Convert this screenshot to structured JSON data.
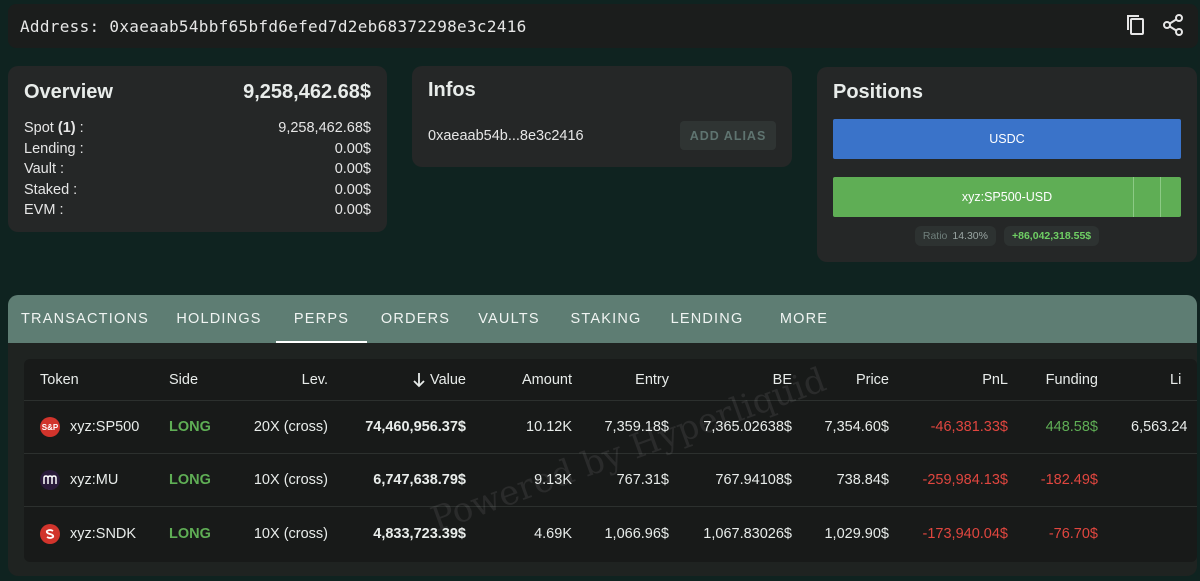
{
  "address": {
    "label": "Address:",
    "value": "0xaeaab54bbf65bfd6efed7d2eb68372298e3c2416"
  },
  "icons": {
    "copy": "copy-icon",
    "share": "share-icon"
  },
  "overview": {
    "title": "Overview",
    "total": "9,258,462.68$",
    "rows": [
      {
        "label_prefix": "Spot ",
        "label_bold": "(1)",
        "label_suffix": " :",
        "value": "9,258,462.68$"
      },
      {
        "label": "Lending :",
        "value": "0.00$"
      },
      {
        "label": "Vault :",
        "value": "0.00$"
      },
      {
        "label": "Staked :",
        "value": "0.00$"
      },
      {
        "label": "EVM :",
        "value": "0.00$"
      }
    ]
  },
  "infos": {
    "title": "Infos",
    "short_address": "0xaeaab54b...8e3c2416",
    "add_alias": "ADD ALIAS"
  },
  "positions": {
    "title": "Positions",
    "bars": [
      {
        "label": "USDC",
        "color": "#3a73c9"
      },
      {
        "label": "xyz:SP500-USD",
        "color": "#5fae55"
      }
    ],
    "ratio_label": "Ratio",
    "ratio_value": "14.30%",
    "pnl": "+86,042,318.55$"
  },
  "tabs": [
    "TRANSACTIONS",
    "HOLDINGS",
    "PERPS",
    "ORDERS",
    "VAULTS",
    "STAKING",
    "LENDING",
    "MORE"
  ],
  "active_tab": "PERPS",
  "table": {
    "headers": {
      "token": "Token",
      "side": "Side",
      "lev": "Lev.",
      "value": "Value",
      "amount": "Amount",
      "entry": "Entry",
      "be": "BE",
      "price": "Price",
      "pnl": "PnL",
      "funding": "Funding",
      "liq": "Li"
    },
    "rows": [
      {
        "token": "xyz:SP500",
        "side": "LONG",
        "lev": "20X (cross)",
        "value": "74,460,956.37$",
        "amount": "10.12K",
        "entry": "7,359.18$",
        "be": "7,365.02638$",
        "price": "7,354.60$",
        "pnl": "-46,381.33$",
        "funding": "448.58$",
        "liq": "6,563.24"
      },
      {
        "token": "xyz:MU",
        "side": "LONG",
        "lev": "10X (cross)",
        "value": "6,747,638.79$",
        "amount": "9.13K",
        "entry": "767.31$",
        "be": "767.94108$",
        "price": "738.84$",
        "pnl": "-259,984.13$",
        "funding": "-182.49$",
        "liq": ""
      },
      {
        "token": "xyz:SNDK",
        "side": "LONG",
        "lev": "10X (cross)",
        "value": "4,833,723.39$",
        "amount": "4.69K",
        "entry": "1,066.96$",
        "be": "1,067.83026$",
        "price": "1,029.90$",
        "pnl": "-173,940.04$",
        "funding": "-76.70$",
        "liq": ""
      }
    ]
  },
  "watermark": "Powered by Hyperliquid"
}
